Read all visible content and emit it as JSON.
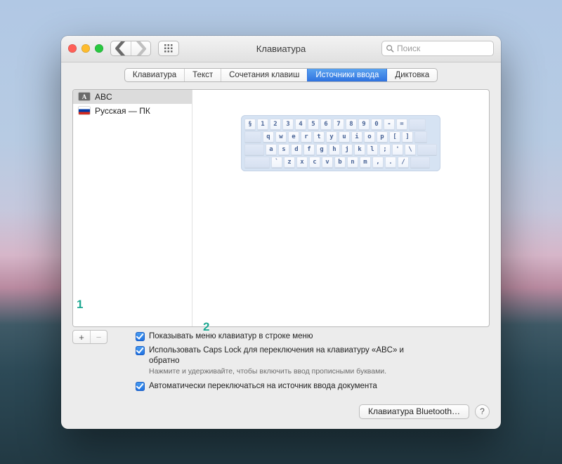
{
  "window": {
    "title": "Клавиатура"
  },
  "search": {
    "placeholder": "Поиск"
  },
  "tabs": [
    {
      "label": "Клавиатура",
      "selected": false
    },
    {
      "label": "Текст",
      "selected": false
    },
    {
      "label": "Сочетания клавиш",
      "selected": false
    },
    {
      "label": "Источники ввода",
      "selected": true
    },
    {
      "label": "Диктовка",
      "selected": false
    }
  ],
  "sources": [
    {
      "label": "ABC",
      "flag": "abc",
      "selected": true
    },
    {
      "label": "Русская — ПК",
      "flag": "rus",
      "selected": false
    }
  ],
  "keyboard_rows": [
    [
      "§",
      "1",
      "2",
      "3",
      "4",
      "5",
      "6",
      "7",
      "8",
      "9",
      "0",
      "-",
      "="
    ],
    [
      "q",
      "w",
      "e",
      "r",
      "t",
      "y",
      "u",
      "i",
      "o",
      "p",
      "[",
      "]"
    ],
    [
      "a",
      "s",
      "d",
      "f",
      "g",
      "h",
      "j",
      "k",
      "l",
      ";",
      "'",
      "\\"
    ],
    [
      "`",
      "z",
      "x",
      "c",
      "v",
      "b",
      "n",
      "m",
      ",",
      ".",
      "/"
    ]
  ],
  "addremove": {
    "add": "+",
    "remove": "−"
  },
  "opts": {
    "show_menu": "Показывать меню клавиатур в строке меню",
    "capslock": "Использовать Caps Lock для переключения на клавиатуру «ABC» и обратно",
    "capslock_hint": "Нажмите и удерживайте, чтобы включить ввод прописными буквами.",
    "auto_switch": "Автоматически переключаться на источник ввода документа"
  },
  "footer": {
    "bt": "Клавиатура Bluetooth…",
    "help": "?"
  },
  "annotations": {
    "a1": "1",
    "a2": "2"
  }
}
